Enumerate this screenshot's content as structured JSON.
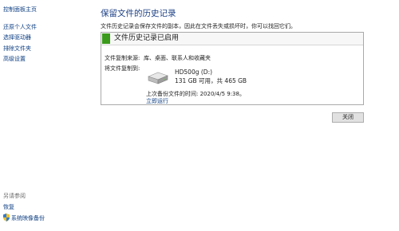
{
  "sidebar": {
    "home": "控制面板主页",
    "items": [
      {
        "label": "还原个人文件"
      },
      {
        "label": "选择驱动器"
      },
      {
        "label": "排除文件夹"
      },
      {
        "label": "高级设置"
      }
    ],
    "see_also": {
      "heading": "另请参阅",
      "links": [
        {
          "label": "恢复"
        },
        {
          "label": "系统映像备份",
          "icon": "shield-icon"
        }
      ]
    }
  },
  "main": {
    "title": "保留文件的历史记录",
    "subtitle": "文件历史记录会保存文件的副本，因此在文件丢失或损坏时，你可以找回它们。",
    "status": {
      "text": "文件历史记录已启用",
      "color": "#3b9a1b"
    },
    "source_label": "文件复制来源:",
    "source_value": "库、桌面、联系人和收藏夹",
    "target_label": "将文件复制到:",
    "drive": {
      "icon": "hard-drive-icon",
      "name": "HD500g (D:)",
      "space": "131 GB 可用，共 465 GB"
    },
    "last_backup": "上次备份文件的时间: 2020/4/5 9:38。",
    "run_now": "立即运行",
    "close": "关闭"
  }
}
